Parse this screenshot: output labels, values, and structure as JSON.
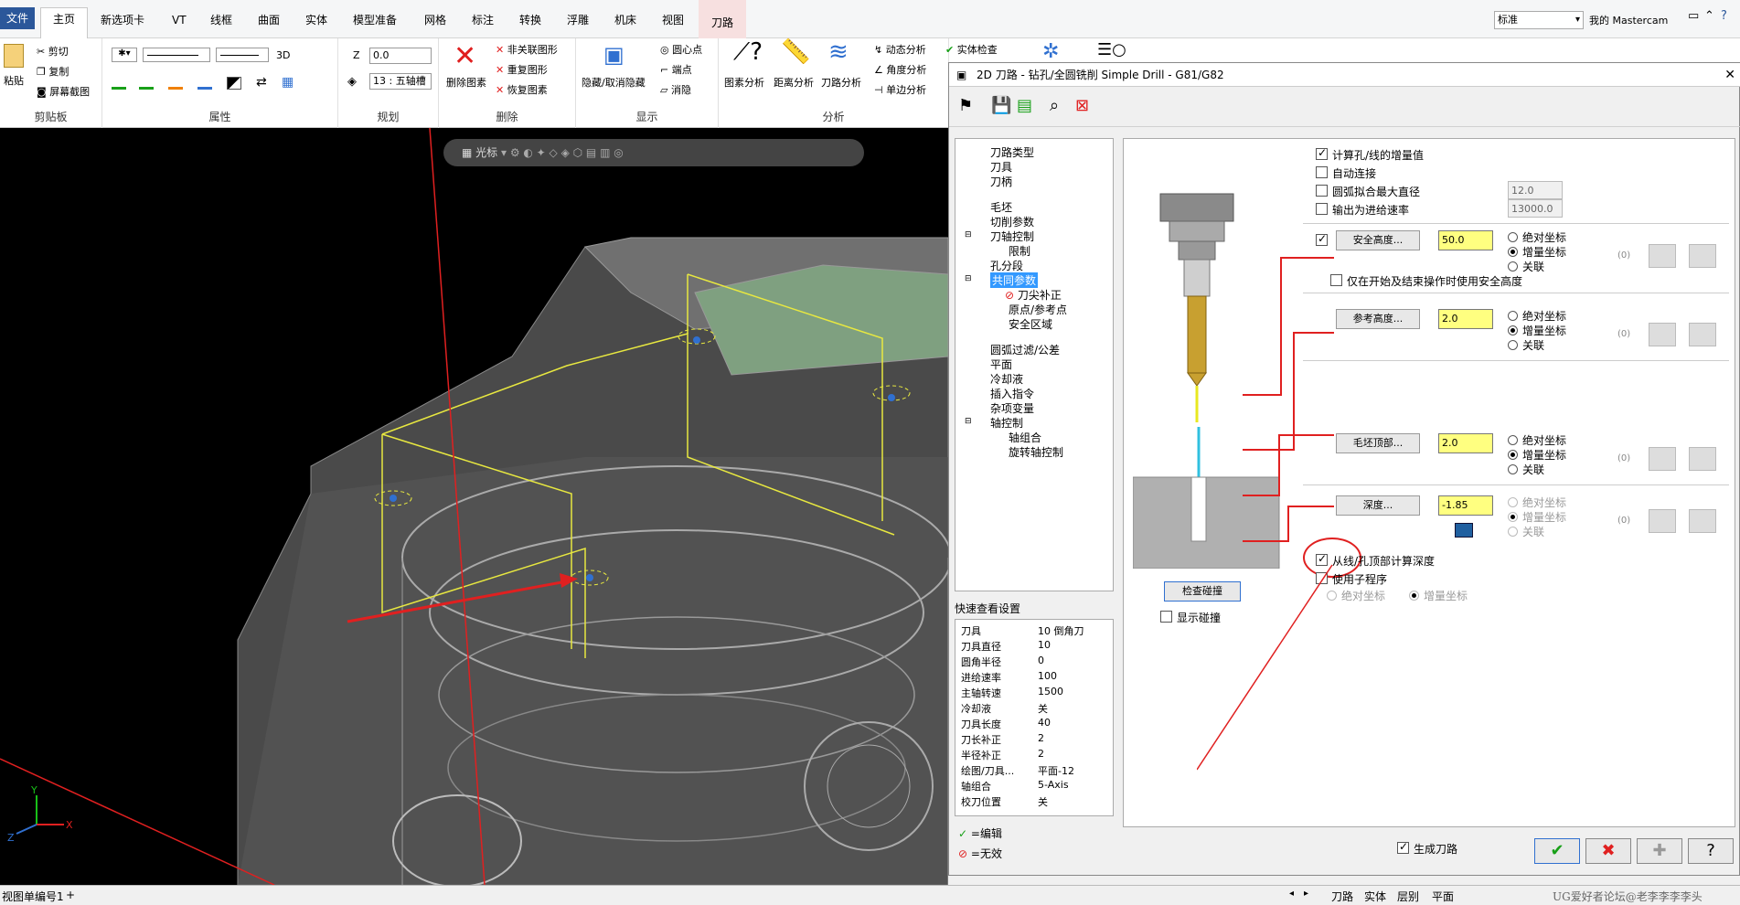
{
  "tabs": [
    "文件",
    "主页",
    "新选项卡",
    "VT",
    "线框",
    "曲面",
    "实体",
    "模型准备",
    "网格",
    "标注",
    "转换",
    "浮雕",
    "机床",
    "视图",
    "刀路"
  ],
  "topright": {
    "combo": "标准",
    "my": "我的 Mastercam"
  },
  "ribbon": {
    "clipboard": {
      "paste": "粘贴",
      "cut": "剪切",
      "copy": "复制",
      "screenshot": "屏幕截图",
      "label": "剪贴板"
    },
    "attrs": {
      "label": "属性",
      "three_d": "3D"
    },
    "plan": {
      "z": "Z",
      "z_value": "0.0",
      "layer": "13 : 五轴槽",
      "label": "规划"
    },
    "del": {
      "delete_entity": "删除图素",
      "nonassoc": "非关联图形",
      "dup": "重复图形",
      "restore": "恢复图素",
      "label": "删除"
    },
    "display": {
      "hide": "隐藏/取消隐藏",
      "center": "圆心点",
      "endpoint": "端点",
      "clear": "消隐",
      "label": "显示"
    },
    "analysis": {
      "entity": "图素分析",
      "dist": "距离分析",
      "toolpath": "刀路分析",
      "dynamic": "动态分析",
      "angle": "角度分析",
      "single": "单边分析",
      "solidcheck": "实体检查",
      "label": "分析"
    }
  },
  "viewport": {
    "toolbar": "光标"
  },
  "dialog": {
    "title": "2D 刀路 - 钻孔/全圆铣削 Simple Drill - G81/G82",
    "tree": [
      "刀路类型",
      "刀具",
      "刀柄",
      "毛坯",
      "切削参数",
      "刀轴控制",
      "限制",
      "孔分段",
      "共同参数",
      "刀尖补正",
      "原点/参考点",
      "安全区域",
      "圆弧过滤/公差",
      "平面",
      "冷却液",
      "插入指令",
      "杂项变量",
      "轴控制",
      "轴组合",
      "旋转轴控制"
    ],
    "quickview_title": "快速查看设置",
    "quickview": [
      [
        "刀具",
        "10 倒角刀"
      ],
      [
        "刀具直径",
        "10"
      ],
      [
        "圆角半径",
        "0"
      ],
      [
        "进给速率",
        "100"
      ],
      [
        "主轴转速",
        "1500"
      ],
      [
        "冷却液",
        "关"
      ],
      [
        "刀具长度",
        "40"
      ],
      [
        "刀长补正",
        "2"
      ],
      [
        "半径补正",
        "2"
      ],
      [
        "绘图/刀具...",
        "平面-12"
      ],
      [
        "轴组合",
        "5-Axis"
      ],
      [
        "校刀位置",
        "关"
      ]
    ],
    "legend": {
      "edit": "=编辑",
      "invalid": "=无效"
    },
    "params": {
      "calc_inc": "计算孔/线的增量值",
      "auto_link": "自动连接",
      "arc_max_dia": "圆弧拟合最大直径",
      "arc_max_dia_value": "12.0",
      "output_feed": "输出为进给速率",
      "output_feed_value": "13000.0",
      "clearance": "安全高度...",
      "clearance_value": "50.0",
      "clearance_only": "仅在开始及结束操作时使用安全高度",
      "retract": "参考高度...",
      "retract_value": "2.0",
      "stock_top": "毛坯顶部...",
      "stock_top_value": "2.0",
      "depth": "深度...",
      "depth_value": "-1.85",
      "abs": "绝对坐标",
      "inc": "增量坐标",
      "assoc": "关联",
      "zero": "(0)",
      "from_top": "从线/孔顶部计算深度",
      "subprog": "使用子程序",
      "sub_abs": "绝对坐标",
      "sub_inc": "增量坐标",
      "check_collision": "检查碰撞",
      "show_collision": "显示碰撞",
      "gen_toolpath": "生成刀路"
    }
  },
  "bottombar": {
    "tab1": "视图单编号1",
    "plus": "+",
    "t_toolpath": "刀路",
    "t_solid": "实体",
    "t_layer": "层别",
    "t_plane": "平面",
    "watermark": "UG爱好者论坛@老李李李李头"
  },
  "colors": {
    "accent": "#2b579a",
    "field_yellow": "#ffff80",
    "annotation_red": "#e02020"
  }
}
